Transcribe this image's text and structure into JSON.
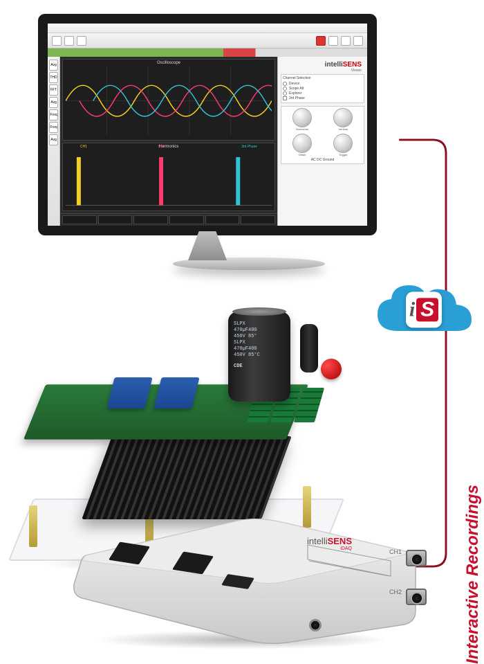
{
  "brand": {
    "prefix": "intelli",
    "suffix": "SENS",
    "viewer": "Viewer"
  },
  "software": {
    "osc_title": "Oscilloscope",
    "harm_title": "Harmonics",
    "channels": {
      "ch1": "CH1",
      "ch2": "CH2",
      "ch3": "3rd Phase"
    },
    "right_panel": {
      "section1_title": "Channel Selection",
      "radios": [
        "Device",
        "Scope Att",
        "Explorer"
      ],
      "check": "3rd Phase",
      "knob_labels": [
        "Horizontal",
        "Vertical",
        "Offset",
        "Trigger"
      ],
      "bottom_row": "AC   DC   Ground"
    },
    "left_rail": [
      "Avg",
      "THD",
      "FFT",
      "Avg",
      "Freq",
      "Freq",
      "Avg"
    ]
  },
  "cloud": {
    "badge_i": "i",
    "badge_s": "S"
  },
  "side_label": "Interactive Recordings",
  "capacitor": {
    "line1": "SLPX",
    "line2": "470µF400",
    "line3": "450V 85°",
    "line4": "SLPX",
    "line5": "470µF400",
    "line6": "450V 85°C",
    "brand": "CDE"
  },
  "daq": {
    "brand_prefix": "intelli",
    "brand_suffix": "SENS",
    "sub": "iDAQ",
    "ch1": "CH1",
    "ch2": "CH2"
  }
}
